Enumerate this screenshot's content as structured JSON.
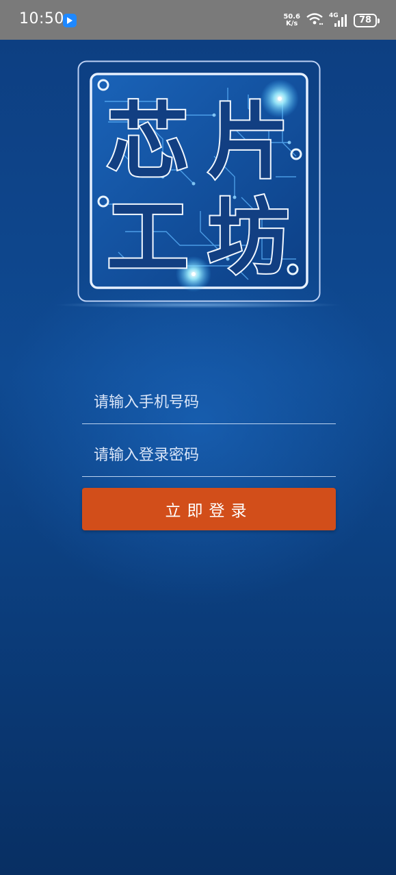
{
  "status_bar": {
    "time": "10:50",
    "app_icon": "notification-app-icon",
    "net_speed_value": "50.6",
    "net_speed_unit": "K/s",
    "wifi_icon": "wifi-icon",
    "network_type": "4G",
    "signal_icon": "cell-signal-icon",
    "battery_level": "78"
  },
  "logo": {
    "text": "芯片工坊",
    "chars": [
      "芯",
      "片",
      "工",
      "坊"
    ],
    "frame_color": "#dbe9ff",
    "glow_color": "#6fdcff"
  },
  "login_form": {
    "phone_placeholder": "请输入手机号码",
    "password_placeholder": "请输入登录密码",
    "login_label": "立即登录",
    "button_color": "#d24e1a"
  }
}
